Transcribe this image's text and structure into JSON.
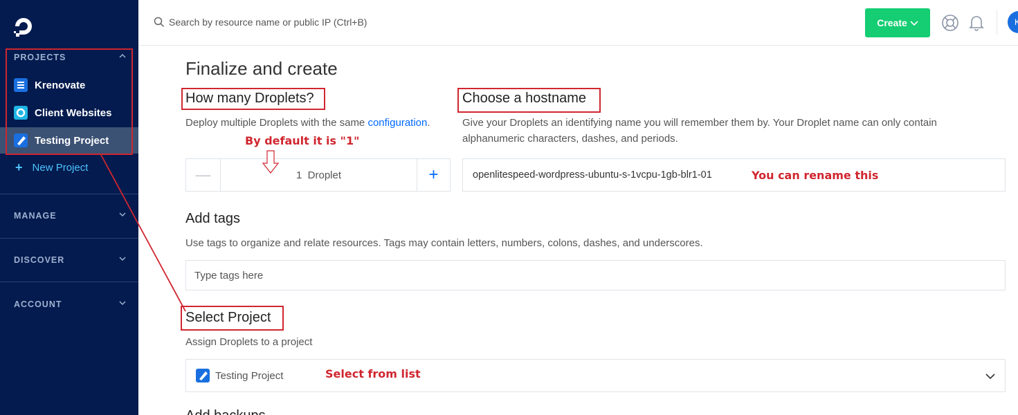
{
  "sidebar": {
    "projects_label": "PROJECTS",
    "projects": [
      {
        "label": "Krenovate",
        "icon": "project-list-icon",
        "color": "#1a6fe0"
      },
      {
        "label": "Client Websites",
        "icon": "project-circle-icon",
        "color": "#1fb6e6"
      },
      {
        "label": "Testing Project",
        "icon": "project-pencil-icon",
        "color": "#1a6fe0",
        "active": true
      }
    ],
    "new_project_label": "New Project",
    "manage_label": "MANAGE",
    "discover_label": "DISCOVER",
    "account_label": "ACCOUNT"
  },
  "topbar": {
    "search_placeholder": "Search by resource name or public IP (Ctrl+B)",
    "create_label": "Create",
    "avatar_initial": "K"
  },
  "main": {
    "title": "Finalize and create",
    "droplets": {
      "heading": "How many Droplets?",
      "desc_prefix": "Deploy multiple Droplets with the same ",
      "desc_link": "configuration",
      "desc_suffix": ".",
      "count": "1",
      "unit": "Droplet",
      "minus": "—",
      "plus": "+"
    },
    "hostname": {
      "heading": "Choose a hostname",
      "desc": "Give your Droplets an identifying name you will remember them by. Your Droplet name can only contain alphanumeric characters, dashes, and periods.",
      "value": "openlitespeed-wordpress-ubuntu-s-1vcpu-1gb-blr1-01"
    },
    "tags": {
      "heading": "Add tags",
      "desc": "Use tags to organize and relate resources. Tags may contain letters, numbers, colons, dashes, and underscores.",
      "placeholder": "Type tags here"
    },
    "project": {
      "heading": "Select Project",
      "desc": "Assign Droplets to a project",
      "selected": "Testing Project"
    },
    "next_heading": "Add backups"
  },
  "annotations": {
    "default_note": "By default it is \"1\"",
    "rename_note": "You can rename this",
    "select_note": "Select from list",
    "color": "#d0262f"
  },
  "colors": {
    "sidebar_bg": "#031b4e",
    "accent_blue": "#0069ff",
    "create_green": "#15cd72"
  }
}
